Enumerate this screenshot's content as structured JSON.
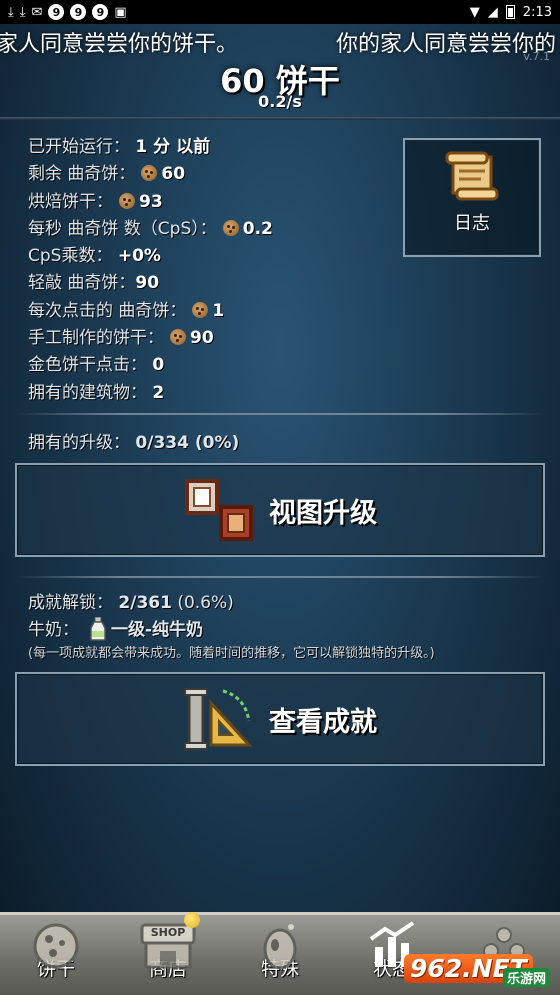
{
  "status_bar": {
    "circled_digits": [
      "9",
      "9",
      "9"
    ],
    "time": "2:13"
  },
  "ticker": {
    "text_a": "家人同意尝尝你的饼干。",
    "text_b": "你的家人同意尝尝你的"
  },
  "version": "v.7.1",
  "header": {
    "cookies": "60 饼干",
    "cps": "0.2/s"
  },
  "stats": {
    "started": {
      "label": "已开始运行：",
      "value": "1 分 以前"
    },
    "banked": {
      "label": "剩余 曲奇饼：",
      "value": "60"
    },
    "baked": {
      "label": "烘焙饼干：",
      "value": "93"
    },
    "cps": {
      "label": "每秒 曲奇饼 数（CpS）：",
      "value": "0.2"
    },
    "multiplier": {
      "label": "CpS乘数：",
      "value": "+0%"
    },
    "clicks": {
      "label": "轻敲 曲奇饼：",
      "value": "90"
    },
    "per_click": {
      "label": "每次点击的 曲奇饼：",
      "value": "1"
    },
    "handmade": {
      "label": "手工制作的饼干：",
      "value": "90"
    },
    "golden": {
      "label": "金色饼干点击：",
      "value": "0"
    },
    "buildings": {
      "label": "拥有的建筑物：",
      "value": "2"
    }
  },
  "log_button": {
    "label": "日志"
  },
  "upgrades": {
    "label": "拥有的升级：",
    "value": "0/334 (0%)",
    "button_label": "视图升级"
  },
  "achievements": {
    "label": "成就解锁：",
    "value": "2/361",
    "percent": "(0.6%)",
    "milk_label": "牛奶：",
    "milk_value": "一级-纯牛奶",
    "note": "(每一项成就都会带来成功。随着时间的推移，它可以解锁独特的升级。)",
    "button_label": "查看成就"
  },
  "tabs": [
    {
      "label": "饼干",
      "icon": "cookie-icon"
    },
    {
      "label": "商店",
      "icon": "shop-icon",
      "badge_text": "SHOP"
    },
    {
      "label": "特殊",
      "icon": "egg-icon"
    },
    {
      "label": "状态",
      "icon": "stats-icon"
    },
    {
      "label": "",
      "icon": "settings-icon"
    }
  ],
  "watermark": {
    "logo": "962.NET",
    "sub": "乐游网"
  },
  "colors": {
    "background": "#1b3a52",
    "tab_bar": "#7a7a75",
    "watermark_orange": "#ff7a2a"
  }
}
